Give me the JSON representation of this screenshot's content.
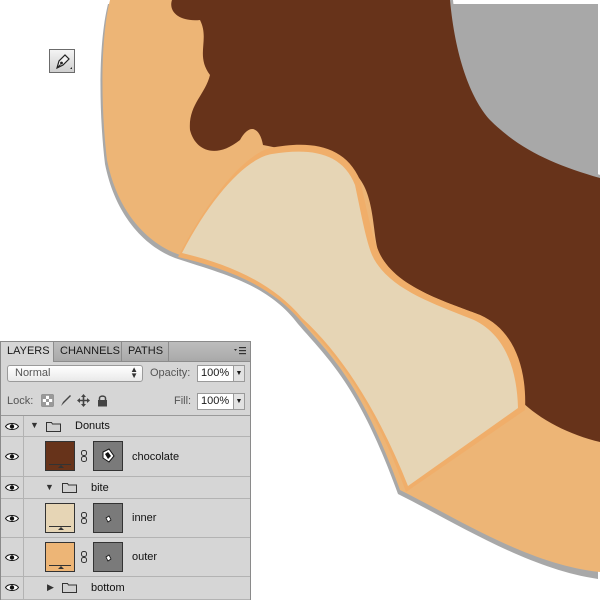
{
  "canvas": {
    "background": "#ffffff",
    "colors": {
      "outer_dough": "#EDB576",
      "chocolate": "#67331A",
      "bite_inner": "#E6D5B5",
      "bite_edge": "#F0AE6A",
      "shadow": "#A8A8A8"
    }
  },
  "toolbar": {
    "tool_icon": "pen-tool-icon"
  },
  "layers_panel": {
    "tabs": [
      {
        "label": "LAYERS",
        "active": true
      },
      {
        "label": "CHANNELS",
        "active": false
      },
      {
        "label": "PATHS",
        "active": false
      }
    ],
    "menu_icon": "panel-menu-icon",
    "blend_mode": "Normal",
    "opacity_label": "Opacity:",
    "opacity_value": "100%",
    "lock_label": "Lock:",
    "lock_icons": [
      "lock-transparent-icon",
      "lock-paint-icon",
      "lock-move-icon",
      "lock-all-icon"
    ],
    "fill_label": "Fill:",
    "fill_value": "100%",
    "layers": [
      {
        "type": "group",
        "name": "Donuts",
        "expanded": true,
        "indent": 0
      },
      {
        "type": "layer",
        "name": "chocolate",
        "fill_color": "#67331A",
        "indent": 1
      },
      {
        "type": "group",
        "name": "bite",
        "expanded": true,
        "indent": 1
      },
      {
        "type": "layer",
        "name": "inner",
        "fill_color": "#E6D5B5",
        "indent": 2
      },
      {
        "type": "layer",
        "name": "outer",
        "fill_color": "#EDB576",
        "indent": 2
      },
      {
        "type": "group",
        "name": "bottom",
        "expanded": false,
        "indent": 1
      }
    ]
  }
}
